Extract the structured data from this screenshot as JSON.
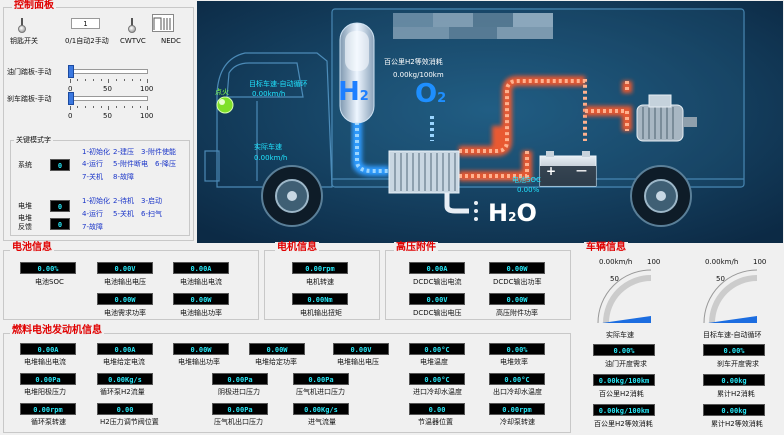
{
  "control_panel": {
    "title": "控制面板",
    "key_switch_label": "钥匙开关",
    "mode_value": "1",
    "mode_label": "0/1自动2手动",
    "cwtvc_label": "CWTVC",
    "nedc_label": "NEDC",
    "throttle_label": "油门踏板-手动",
    "throttle_ticks": [
      "0",
      "50",
      "100"
    ],
    "brake_label": "刹车踏板-手动",
    "brake_ticks": [
      "0",
      "50",
      "100"
    ],
    "key_modes_title": "关键模式字",
    "system_label": "系统",
    "system_value": "0",
    "system_modes": [
      [
        "1-初始化",
        "2-建压",
        "3-附件使能"
      ],
      [
        "4-运行",
        "5-附件断电",
        "6-降压"
      ],
      [
        "7-关机",
        "8-故障"
      ]
    ],
    "stack_label": "电堆",
    "stack_value": "0",
    "stack_feedback_label": "电堆\n反馈",
    "stack_feedback_value": "0",
    "stack_modes": [
      [
        "1-初始化",
        "2-待机",
        "3-启动"
      ],
      [
        "4-运行",
        "5-关机",
        "6-扫气"
      ],
      [
        "7-故障"
      ]
    ]
  },
  "diagram": {
    "target_speed_label": "目标车速-自动循环",
    "target_speed_value": "0.00km/h",
    "ignition_label": "点火",
    "actual_speed_label": "实际车速",
    "actual_speed_value": "0.00km/h",
    "h2_per100_label": "百公里H2等效消耗",
    "h2_per100_value": "0.00kg/100km",
    "soc_label": "电池SOC",
    "soc_value": "0.00%",
    "h2_text": "H",
    "h2_sub": "2",
    "o2_text": "O",
    "o2_sub": "2",
    "h2o_text": "H",
    "h2o_sub": "2",
    "h2o_tail": "O",
    "plus": "+",
    "minus": "—"
  },
  "battery": {
    "title": "电池信息",
    "items": [
      {
        "value": "0.00%",
        "label": "电池SOC"
      },
      {
        "value": "0.00V",
        "label": "电池输出电压"
      },
      {
        "value": "0.00A",
        "label": "电池输出电流"
      },
      {
        "value": "0.00W",
        "label": "电池需求功率"
      },
      {
        "value": "0.00W",
        "label": "电池输出功率"
      }
    ]
  },
  "motor": {
    "title": "电机信息",
    "items": [
      {
        "value": "0.00rpm",
        "label": "电机转速"
      },
      {
        "value": "0.00Nm",
        "label": "电机输出扭矩"
      }
    ]
  },
  "hv": {
    "title": "高压附件",
    "items": [
      {
        "value": "0.00A",
        "label": "DCDC输出电流"
      },
      {
        "value": "0.00W",
        "label": "DCDC输出功率"
      },
      {
        "value": "0.00V",
        "label": "DCDC输出电压"
      },
      {
        "value": "0.00W",
        "label": "高压附件功率"
      }
    ]
  },
  "fuelcell": {
    "title": "燃料电池发动机信息",
    "rows": [
      [
        {
          "value": "0.00A",
          "label": "电堆输出电流"
        },
        {
          "value": "0.00A",
          "label": "电堆给定电流"
        },
        {
          "value": "0.00W",
          "label": "电堆输出功率"
        },
        {
          "value": "0.00W",
          "label": "电堆给定功率"
        },
        {
          "value": "0.00V",
          "label": "电堆输出电压"
        },
        {
          "value": "0.00°C",
          "label": "电堆温度"
        },
        {
          "value": "0.00%",
          "label": "电堆效率"
        }
      ],
      [
        {
          "value": "0.00Pa",
          "label": "电堆阳极压力"
        },
        {
          "value": "0.00Kg/s",
          "label": "循环泵H2流量"
        },
        {
          "value": "0.00Pa",
          "label": "阴极进口压力"
        },
        {
          "value": "0.00Pa",
          "label": "压气机进口压力"
        },
        {
          "value": "0.00°C",
          "label": "进口冷却水温度"
        },
        {
          "value": "0.00°C",
          "label": "出口冷却水温度"
        }
      ],
      [
        {
          "value": "0.00rpm",
          "label": "循环泵转速"
        },
        {
          "value": "0.00",
          "label": "H2压力调节阀位置"
        },
        {
          "value": "0.00Pa",
          "label": "压气机出口压力"
        },
        {
          "value": "0.00Kg/s",
          "label": "进气流量"
        },
        {
          "value": "0.00",
          "label": "节温器位置"
        },
        {
          "value": "0.00rpm",
          "label": "冷却泵转速"
        }
      ]
    ]
  },
  "vehicle": {
    "title": "车辆信息",
    "gauge1": {
      "unit_value": "0.00km/h",
      "max": "100",
      "mid": "50",
      "min": "0",
      "label": "实际车速",
      "level": 0
    },
    "gauge2": {
      "unit_value": "0.00km/h",
      "max": "100",
      "mid": "50",
      "min": "0",
      "label": "目标车速-自动循环",
      "level": 0
    },
    "items": [
      {
        "value": "0.00%",
        "label": "油门开度需求"
      },
      {
        "value": "0.00%",
        "label": "刹车开度需求"
      },
      {
        "value": "0.00kg/100km",
        "label": "百公里H2消耗"
      },
      {
        "value": "0.00kg",
        "label": "累计H2消耗"
      },
      {
        "value": "0.00kg/100km",
        "label": "百公里H2等效消耗"
      },
      {
        "value": "0.00kg",
        "label": "累计H2等效消耗"
      }
    ]
  },
  "colors": {
    "title_red": "#e00000",
    "display_bg": "#000000",
    "display_text": "#27e6f5",
    "mode_blue": "#1a35c8",
    "slider_blue": "#2a64d6"
  }
}
